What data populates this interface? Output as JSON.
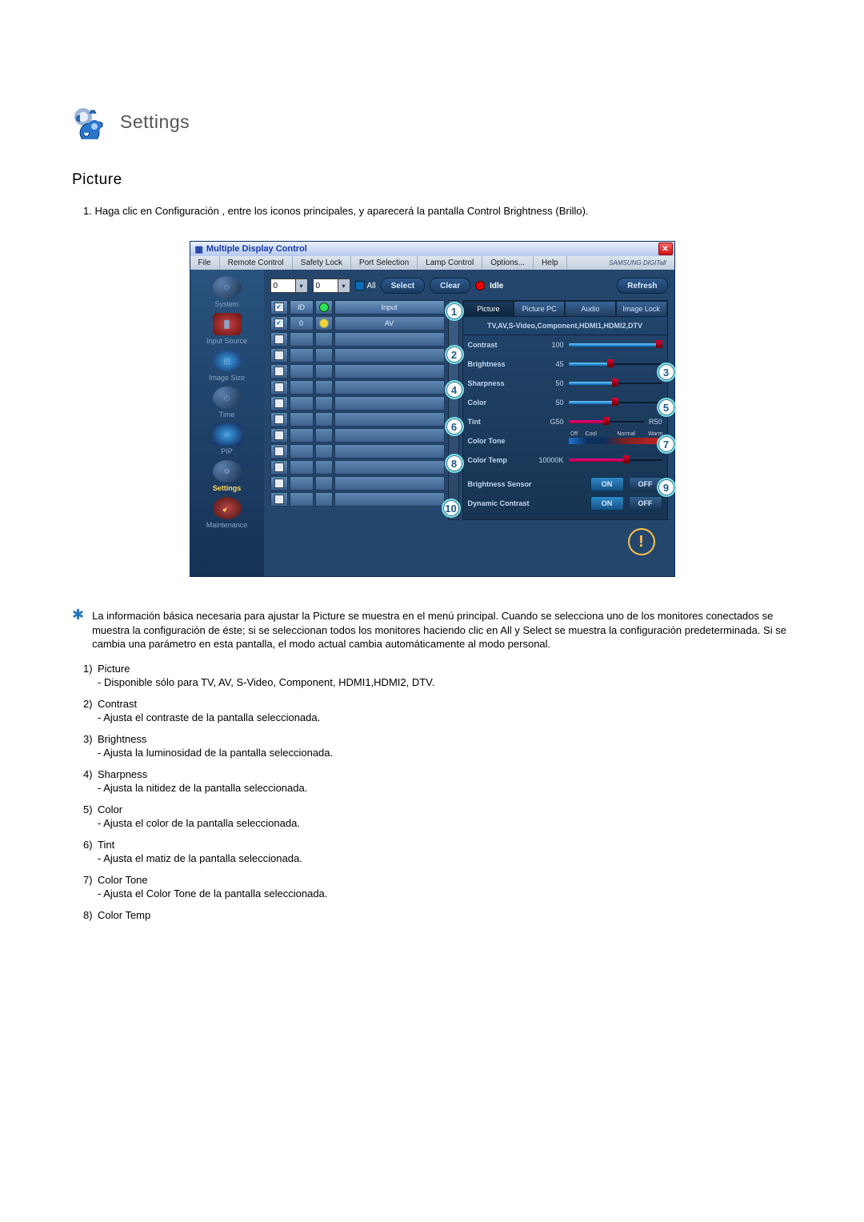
{
  "header": {
    "title": "Settings"
  },
  "section": {
    "title": "Picture"
  },
  "intro": "1. Haga clic en Configuración , entre los iconos principales, y aparecerá la pantalla Control Brightness (Brillo).",
  "window": {
    "title": "Multiple Display Control",
    "brand": "SAMSUNG DIGITall",
    "menu": [
      "File",
      "Remote Control",
      "Safety Lock",
      "Port Selection",
      "Lamp Control",
      "Options...",
      "Help"
    ],
    "sidebar": [
      {
        "label": "System"
      },
      {
        "label": "Input Source"
      },
      {
        "label": "Image Size"
      },
      {
        "label": "Time"
      },
      {
        "label": "PIP"
      },
      {
        "label": "Settings",
        "selected": true
      },
      {
        "label": "Maintenance"
      }
    ],
    "toolbar": {
      "sel1": "0",
      "sel2": "0",
      "all": "All",
      "select": "Select",
      "clear": "Clear",
      "idle": "Idle",
      "refresh": "Refresh"
    },
    "grid": {
      "headers": [
        "",
        "ID",
        "",
        "Input"
      ],
      "rows": [
        {
          "chk": true,
          "id": "0",
          "live": "yel",
          "input": "AV"
        },
        {
          "chk": false
        },
        {
          "chk": false
        },
        {
          "chk": false
        },
        {
          "chk": false
        },
        {
          "chk": false
        },
        {
          "chk": false
        },
        {
          "chk": false
        },
        {
          "chk": false
        },
        {
          "chk": false
        },
        {
          "chk": false
        },
        {
          "chk": false
        }
      ]
    },
    "tabs": [
      "Picture",
      "Picture PC",
      "Audio",
      "Image Lock"
    ],
    "sources": "TV,AV,S-Video,Component,HDMI1,HDMI2,DTV",
    "controls": {
      "contrast": {
        "label": "Contrast",
        "value": "100",
        "pct": 100
      },
      "brightness": {
        "label": "Brightness",
        "value": "45",
        "pct": 45
      },
      "sharpness": {
        "label": "Sharpness",
        "value": "50",
        "pct": 50
      },
      "color": {
        "label": "Color",
        "value": "50",
        "pct": 50
      },
      "tint": {
        "label": "Tint",
        "value": "G50",
        "r": "R50"
      },
      "colorTone": {
        "label": "Color Tone",
        "marks": [
          "Off",
          "Cool",
          "Normal",
          "Warm"
        ]
      },
      "colorTemp": {
        "label": "Color Temp",
        "value": "10000K",
        "pct": 62
      },
      "brightnessSensor": {
        "label": "Brightness Sensor",
        "on": "ON",
        "off": "OFF"
      },
      "dynamicContrast": {
        "label": "Dynamic Contrast",
        "on": "ON",
        "off": "OFF"
      }
    },
    "callouts": [
      "1",
      "2",
      "3",
      "4",
      "5",
      "6",
      "7",
      "8",
      "9",
      "10"
    ]
  },
  "starNote": "La información básica necesaria para ajustar la Picture se muestra en el menú principal. Cuando se selecciona uno de los monitores conectados se muestra la configuración de éste; si se seleccionan todos los monitores haciendo clic en All y Select se muestra la configuración predeterminada. Si se cambia una parámetro en esta pantalla, el modo actual cambia automáticamente al modo personal.",
  "defs": [
    {
      "n": "1)",
      "t": "Picture",
      "d": "- Disponible sólo para TV, AV, S-Video, Component, HDMI1,HDMI2, DTV."
    },
    {
      "n": "2)",
      "t": "Contrast",
      "d": "- Ajusta el contraste de la pantalla seleccionada."
    },
    {
      "n": "3)",
      "t": "Brightness",
      "d": "- Ajusta la luminosidad de la pantalla seleccionada."
    },
    {
      "n": "4)",
      "t": "Sharpness",
      "d": "- Ajusta la nitidez de la pantalla seleccionada."
    },
    {
      "n": "5)",
      "t": "Color",
      "d": "- Ajusta el color de la pantalla seleccionada."
    },
    {
      "n": "6)",
      "t": "Tint",
      "d": "- Ajusta el matiz de la pantalla seleccionada."
    },
    {
      "n": "7)",
      "t": "Color Tone",
      "d": "- Ajusta el Color Tone de la pantalla seleccionada."
    },
    {
      "n": "8)",
      "t": "Color Temp",
      "d": ""
    }
  ]
}
